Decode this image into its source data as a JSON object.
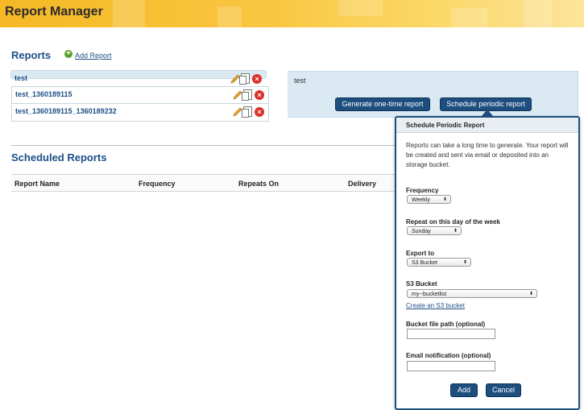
{
  "app": {
    "title": "Report Manager"
  },
  "reports": {
    "heading": "Reports",
    "add_label": "Add Report",
    "rows": [
      {
        "name": "test"
      },
      {
        "name": "test_1360189115"
      },
      {
        "name": "test_1360189115_1360189232"
      }
    ],
    "selected_name": "test",
    "generate_label": "Generate one-time report",
    "schedule_label": "Schedule periodic report"
  },
  "scheduled": {
    "heading": "Scheduled Reports",
    "columns": [
      "Report Name",
      "Frequency",
      "Repeats On",
      "Delivery"
    ]
  },
  "popup": {
    "title": "Schedule Periodic Report",
    "description": "Reports can take a long time to generate. Your report will be created and sent via email or deposited into an storage bucket.",
    "frequency_label": "Frequency",
    "frequency_value": "Weekly",
    "day_label": "Repeat on this day of the week",
    "day_value": "Sunday",
    "export_label": "Export to",
    "export_value": "S3 Bucket",
    "bucket_label": "S3 Bucket",
    "bucket_value": "my--bucketlist",
    "create_bucket_link": "Create an S3 bucket",
    "path_label": "Bucket file path (optional)",
    "path_value": "",
    "email_label": "Email notification (optional)",
    "email_value": "",
    "add_label": "Add",
    "cancel_label": "Cancel"
  },
  "colors": {
    "banner": "#f6b825",
    "accent": "#1d4e7e",
    "selected_row": "#dbe9f3"
  }
}
